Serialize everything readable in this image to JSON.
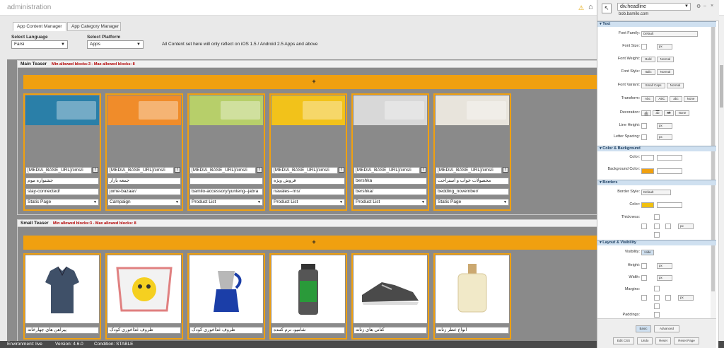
{
  "app": {
    "title": "administration"
  },
  "tabs": [
    {
      "label": "App Content Manager"
    },
    {
      "label": "App Category Manager"
    }
  ],
  "filters": {
    "language_label": "Select Language",
    "language_value": "Farsi",
    "platform_label": "Select Platform",
    "platform_value": "Apps",
    "note": "All Content set here will only reflect on iOS 1.5 / Android 2.5 Apps and above"
  },
  "main_teaser": {
    "title": "Main Teaser",
    "limits": "Min allowed blocks:3 - Max allowed blocks: 8",
    "add_label": "+",
    "cards": [
      {
        "url": "[MEDIA_BASE_URL]/cms/i",
        "name": "جشنواره موم",
        "slug": "stay-connected/",
        "type": "Static Page",
        "banner": "#2a7fa8"
      },
      {
        "url": "[MEDIA_BASE_URL]/cms/i",
        "name": "جمعه بازار",
        "slug": "jome-bazaar/",
        "type": "Campaign",
        "banner": "#f08c2a"
      },
      {
        "url": "[MEDIA_BASE_URL]/cms/i",
        "name": "",
        "slug": "bamilo-accessory/yunteng--jabra",
        "type": "Product List",
        "banner": "#b7cf6a"
      },
      {
        "url": "[MEDIA_BASE_URL]/cms/i",
        "name": "فروش ویژه",
        "slug": "navales--rns/",
        "type": "Product List",
        "banner": "#f2c21a"
      },
      {
        "url": "[MEDIA_BASE_URL]/cms/i",
        "name": "bershka",
        "slug": "bershka/",
        "type": "Product List",
        "banner": "#d8d8d8"
      },
      {
        "url": "[MEDIA_BASE_URL]/cms/i",
        "name": "محصولات خواب و استراحت",
        "slug": "bedding_november/",
        "type": "Static Page",
        "banner": "#e8e4dc"
      }
    ]
  },
  "small_teaser": {
    "title": "Small Teaser",
    "limits": "Min allowed blocks:3 - Max allowed blocks: 8",
    "add_label": "+",
    "cards": [
      {
        "name": "پیراهن های چهارخانه",
        "thumb": "shirt"
      },
      {
        "name": "ظروف غذاخوری کودک",
        "thumb": "plate"
      },
      {
        "name": "ظروف غذاخوری کودک",
        "thumb": "percolator"
      },
      {
        "name": "شامپو، نرم کننده",
        "thumb": "bottle"
      },
      {
        "name": "کتانی های زنانه",
        "thumb": "sneaker"
      },
      {
        "name": "انواع عطر زنانه",
        "thumb": "perfume"
      }
    ]
  },
  "status": {
    "environment": "Environment: live",
    "version": "Version: 4.6.0",
    "condition": "Condition: STABLE"
  },
  "inspector": {
    "selector": "div.headline",
    "host": "bob.bamilo.com",
    "sections": {
      "text": "Text",
      "color": "Color & Background",
      "borders": "Borders",
      "layout": "Layout & Visibility"
    },
    "props": {
      "font_family": "Font Family:",
      "font_family_value": "Default",
      "font_size": "Font Size:",
      "font_weight": "Font Weight:",
      "font_style": "Font Style:",
      "font_variant": "Font Variant:",
      "transform": "Transform:",
      "decoration": "Decoration:",
      "line_height": "Line Height:",
      "letter_spacing": "Letter Spacing:",
      "color": "Color:",
      "bg_color": "Background Color:",
      "border_style": "Border Style:",
      "border_style_value": "Default",
      "border_color": "Color:",
      "thickness": "Thickness:",
      "visibility": "Visibility:",
      "height": "Height:",
      "width": "Width:",
      "margins": "Margins:",
      "paddings": "Paddings:"
    },
    "buttons": {
      "bold": "Bold",
      "normal": "Normal",
      "italic": "Italic",
      "small_caps": "Small Caps",
      "abc1": "Abc",
      "abc2": "ABC",
      "abc3": "abc",
      "none": "None",
      "deco1": "ab",
      "deco2": "ab",
      "deco3": "ab",
      "hide": "Hide",
      "basic": "Basic",
      "advanced": "Advanced",
      "edit_css": "Edit CSS",
      "undo": "Undo",
      "reset": "Reset",
      "reset_page": "Reset Page",
      "unit": "px"
    },
    "colors": {
      "bg": "#f0a010",
      "border": "#f0c010"
    }
  }
}
